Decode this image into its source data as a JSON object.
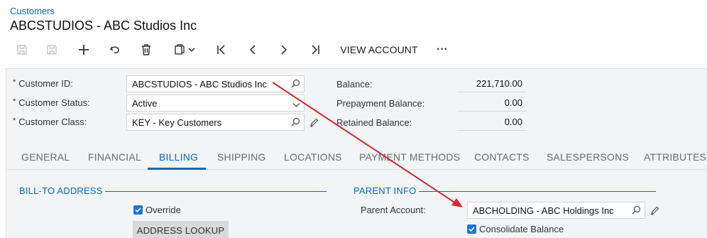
{
  "breadcrumb": "Customers",
  "title": "ABCSTUDIOS - ABC Studios Inc",
  "toolbar": {
    "icons": [
      "save-icon",
      "save-close-icon",
      "add-icon",
      "undo-icon",
      "delete-icon",
      "copy-paste-icon",
      "first-record-icon",
      "previous-record-icon",
      "next-record-icon",
      "last-record-icon",
      "more-icon"
    ],
    "view_account_label": "VIEW ACCOUNT",
    "more_label": "···"
  },
  "summary": {
    "customer_id_label": "Customer ID:",
    "customer_id_value": "ABCSTUDIOS - ABC Studios Inc",
    "customer_status_label": "Customer Status:",
    "customer_status_value": "Active",
    "customer_class_label": "Customer Class:",
    "customer_class_value": "KEY - Key Customers",
    "balance_label": "Balance:",
    "balance_value": "221,710.00",
    "prepayment_label": "Prepayment Balance:",
    "prepayment_value": "0.00",
    "retained_label": "Retained Balance:",
    "retained_value": "0.00",
    "required_mark": "*"
  },
  "tabs": [
    "GENERAL",
    "FINANCIAL",
    "BILLING",
    "SHIPPING",
    "LOCATIONS",
    "PAYMENT METHODS",
    "CONTACTS",
    "SALESPERSONS",
    "ATTRIBUTES"
  ],
  "active_tab": "BILLING",
  "bill_to": {
    "heading": "BILL-TO ADDRESS",
    "override_label": "Override",
    "override_checked": true,
    "address_lookup_label": "ADDRESS LOOKUP"
  },
  "parent_info": {
    "heading": "PARENT INFO",
    "parent_account_label": "Parent Account:",
    "parent_account_value": "ABCHOLDING - ABC Holdings Inc",
    "consolidate_label": "Consolidate Balance",
    "consolidate_checked": true
  },
  "colors": {
    "accent": "#0b6bb8",
    "annotation_arrow": "#d9262e",
    "checkbox": "#1f76d2"
  }
}
